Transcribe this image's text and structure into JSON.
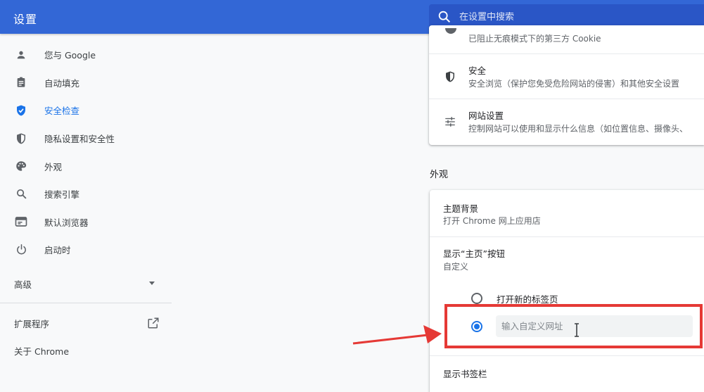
{
  "header": {
    "title": "设置",
    "search_placeholder": "在设置中搜索"
  },
  "sidebar": {
    "items": [
      {
        "label": "您与 Google",
        "icon": "person-icon",
        "active": false
      },
      {
        "label": "自动填充",
        "icon": "clipboard-icon",
        "active": false
      },
      {
        "label": "安全检查",
        "icon": "shield-check-icon",
        "active": true
      },
      {
        "label": "隐私设置和安全性",
        "icon": "shield-icon",
        "active": false
      },
      {
        "label": "外观",
        "icon": "palette-icon",
        "active": false
      },
      {
        "label": "搜索引擎",
        "icon": "search-icon",
        "active": false
      },
      {
        "label": "默认浏览器",
        "icon": "browser-icon",
        "active": false
      },
      {
        "label": "启动时",
        "icon": "power-icon",
        "active": false
      }
    ],
    "advanced_label": "高级",
    "extensions_label": "扩展程序",
    "about_label": "关于 Chrome"
  },
  "privacy_card": {
    "clipped_text": "已阻止无痕模式下的第三方 Cookie",
    "rows": [
      {
        "title": "安全",
        "subtitle": "安全浏览（保护您免受危险网站的侵害）和其他安全设置",
        "icon": "shield-icon"
      },
      {
        "title": "网站设置",
        "subtitle": "控制网站可以使用和显示什么信息（如位置信息、摄像头、",
        "icon": "tune-icon"
      }
    ]
  },
  "appearance": {
    "section_title": "外观",
    "theme_title": "主题背景",
    "theme_subtitle": "打开 Chrome 网上应用店",
    "home_button_title": "显示“主页”按钮",
    "home_button_subtitle": "自定义",
    "radio_new_tab_label": "打开新的标签页",
    "custom_url_placeholder": "输入自定义网址",
    "custom_url_value": "",
    "bookmarks_bar_title": "显示书签栏"
  },
  "colors": {
    "header": "#3367d6",
    "accent": "#1a73e8",
    "highlight": "#e53935"
  }
}
